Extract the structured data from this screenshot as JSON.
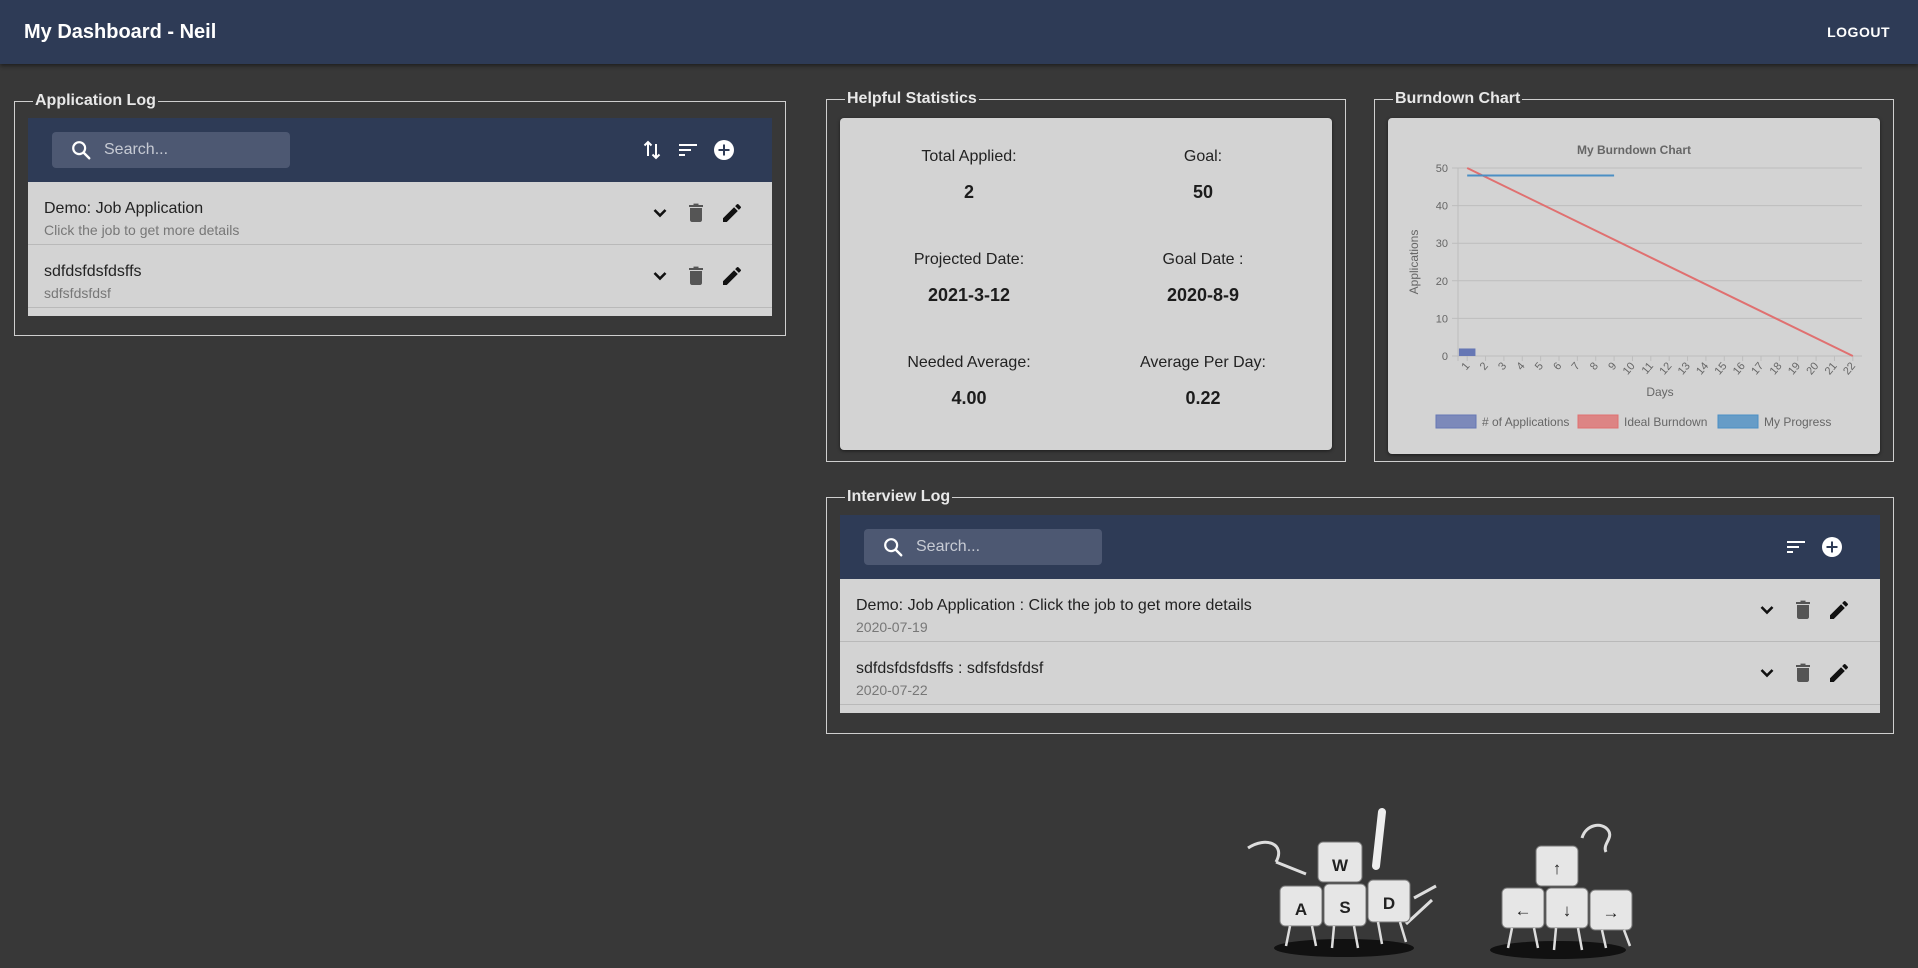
{
  "app": {
    "title": "My Dashboard - Neil",
    "logout_label": "LOGOUT"
  },
  "application_log": {
    "legend": "Application Log",
    "search_placeholder": "Search...",
    "items": [
      {
        "title": "Demo: Job Application",
        "subtitle": "Click the job to get more details"
      },
      {
        "title": "sdfdsfdsfdsffs",
        "subtitle": "sdfsfdsfdsf"
      }
    ]
  },
  "statistics": {
    "legend": "Helpful Statistics",
    "total_applied_label": "Total Applied:",
    "total_applied": "2",
    "goal_label": "Goal:",
    "goal": "50",
    "projected_date_label": "Projected Date:",
    "projected_date": "2021-3-12",
    "goal_date_label": "Goal Date :",
    "goal_date": "2020-8-9",
    "needed_average_label": "Needed Average:",
    "needed_average": "4.00",
    "average_per_day_label": "Average Per Day:",
    "average_per_day": "0.22"
  },
  "burndown": {
    "legend": "Burndown Chart"
  },
  "chart_data": {
    "type": "bar",
    "title": "My Burndown Chart",
    "xlabel": "Days",
    "ylabel": "Applications",
    "categories": [
      "1",
      "2",
      "3",
      "4",
      "5",
      "6",
      "7",
      "8",
      "9",
      "10",
      "11",
      "12",
      "13",
      "14",
      "15",
      "16",
      "17",
      "18",
      "19",
      "20",
      "21",
      "22"
    ],
    "ylim": [
      0,
      50
    ],
    "yticks": [
      0,
      10,
      20,
      30,
      40,
      50
    ],
    "grid": true,
    "legend_position": "bottom",
    "series": [
      {
        "name": "# of Applications",
        "type": "bar",
        "color": "#6677b4",
        "values": [
          2,
          0,
          0,
          0,
          0,
          0,
          0,
          0,
          0,
          0,
          0,
          0,
          0,
          0,
          0,
          0,
          0,
          0,
          0,
          0,
          0,
          0
        ]
      },
      {
        "name": "Ideal Burndown",
        "type": "line",
        "color": "#e07070",
        "x": [
          "1",
          "22"
        ],
        "values": [
          50,
          0
        ]
      },
      {
        "name": "My Progress",
        "type": "line",
        "color": "#4b8fc4",
        "x": [
          "1",
          "9"
        ],
        "values": [
          48,
          48
        ]
      }
    ]
  },
  "interview_log": {
    "legend": "Interview Log",
    "search_placeholder": "Search...",
    "items": [
      {
        "title": "Demo: Job Application : Click the job to get more details",
        "subtitle": "2020-07-19"
      },
      {
        "title": "sdfdsfdsfdsffs : sdfsfdsfdsf",
        "subtitle": "2020-07-22"
      }
    ]
  },
  "decoration": {
    "wasd_keys": [
      "W",
      "A",
      "S",
      "D"
    ],
    "arrow_keys": [
      "↑",
      "←",
      "↓",
      "→"
    ]
  }
}
